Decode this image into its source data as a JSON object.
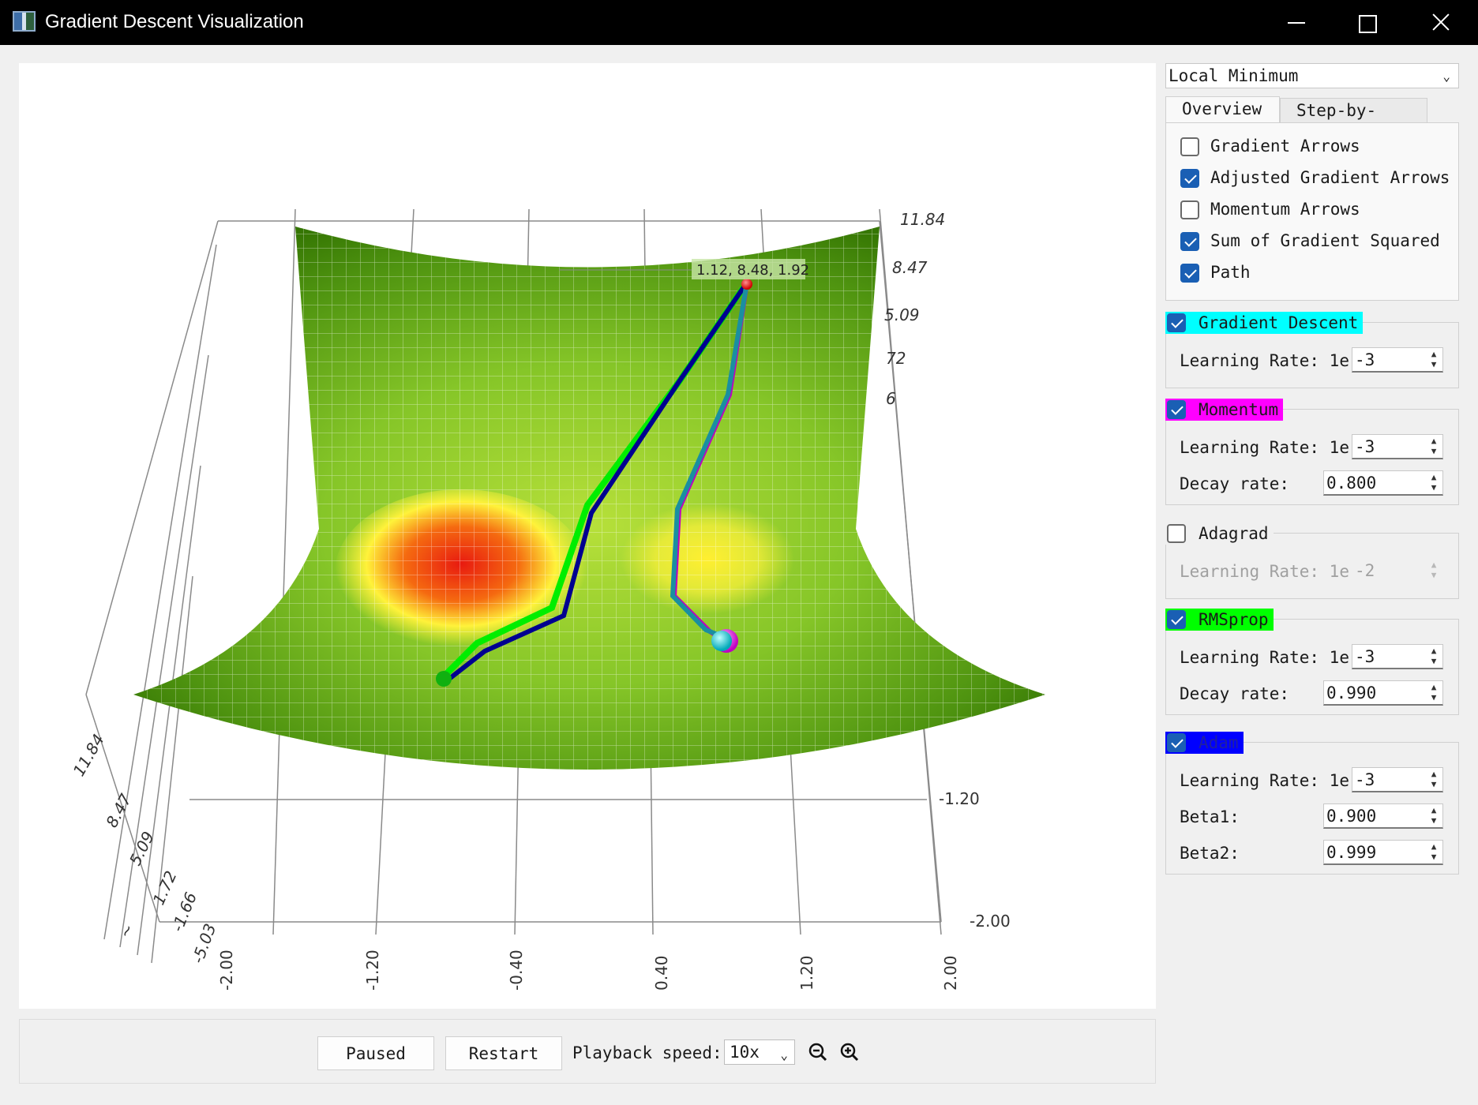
{
  "window": {
    "title": "Gradient Descent Visualization",
    "icon": "chart-app-icon"
  },
  "plot": {
    "tooltip": "1.12, 8.48, 1.92",
    "axis_x_ticks": [
      "-2.00",
      "-1.20",
      "-0.40",
      "0.40",
      "1.20",
      "2.00"
    ],
    "axis_y_ticks": [
      "-2.00",
      "-1.20"
    ],
    "axis_z_ticks_right": [
      "11.84",
      "8.47",
      "5.09",
      "72",
      "6"
    ],
    "axis_z_ticks_left": [
      "11.84",
      "8.47",
      "5.09",
      "1.72",
      "-1.66",
      "-5.03"
    ],
    "left_marker": "~",
    "surface_colors": {
      "high": "#2f6f00",
      "mid": "#9acd32",
      "low": "#ffff33",
      "bottom": "#e01010"
    },
    "path_colors": {
      "gradient_descent": "#00e5e5",
      "momentum": "#ff00ff",
      "rmsprop": "#00ee00",
      "adam": "#000090"
    }
  },
  "controls": {
    "paused_label": "Paused",
    "restart_label": "Restart",
    "speed_label": "Playback speed:",
    "speed_value": "10x",
    "zoom_out_icon": "zoom-out-icon",
    "zoom_in_icon": "zoom-in-icon"
  },
  "panel": {
    "scenario": "Local Minimum",
    "tabs": [
      {
        "label": "Overview"
      },
      {
        "label": "Step-by-Step"
      }
    ],
    "options": [
      {
        "label": "Gradient Arrows",
        "checked": false
      },
      {
        "label": "Adjusted Gradient Arrows",
        "checked": true
      },
      {
        "label": "Momentum Arrows",
        "checked": false
      },
      {
        "label": "Sum of Gradient Squared",
        "checked": true
      },
      {
        "label": "Path",
        "checked": true
      }
    ],
    "optimizers": {
      "gd": {
        "name": "Gradient Descent",
        "color": "#00ffff",
        "lr_label": "Learning Rate:",
        "lr_prefix": "1e",
        "lr": "-3"
      },
      "momentum": {
        "name": "Momentum",
        "color": "#ff00ff",
        "lr_label": "Learning Rate:",
        "lr_prefix": "1e",
        "lr": "-3",
        "decay_label": "Decay rate:",
        "decay": "0.800"
      },
      "adagrad": {
        "name": "Adagrad",
        "lr_label": "Learning Rate:",
        "lr_prefix": "1e",
        "lr": "-2"
      },
      "rmsprop": {
        "name": "RMSprop",
        "color": "#00ff00",
        "lr_label": "Learning Rate:",
        "lr_prefix": "1e",
        "lr": "-3",
        "decay_label": "Decay rate:",
        "decay": "0.990"
      },
      "adam": {
        "name": "Adam",
        "color": "#0000ff",
        "lr_label": "Learning Rate:",
        "lr_prefix": "1e",
        "lr": "-3",
        "beta1_label": "Beta1:",
        "beta1": "0.900",
        "beta2_label": "Beta2:",
        "beta2": "0.999"
      }
    }
  }
}
